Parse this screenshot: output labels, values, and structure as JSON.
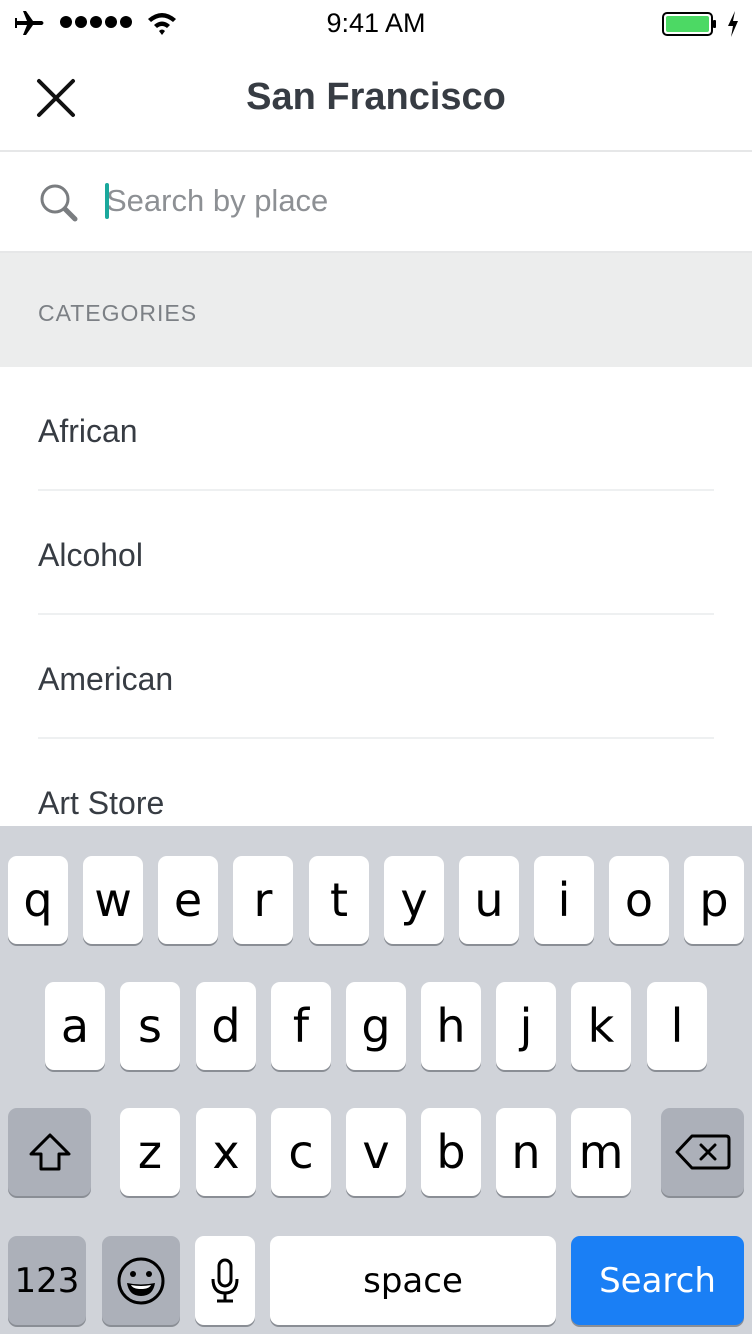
{
  "status_bar": {
    "time": "9:41 AM",
    "airplane_icon": "airplane-icon",
    "signal_dots": 5,
    "wifi_icon": "wifi-icon",
    "battery_level_percent": 100,
    "battery_color": "#4cd964",
    "charging_icon": "bolt-icon"
  },
  "nav": {
    "close_icon": "close-icon",
    "title": "San Francisco"
  },
  "search": {
    "icon": "search-icon",
    "placeholder": "Search by place",
    "value": "",
    "cursor_color": "#1aa89c"
  },
  "categories": {
    "header": "CATEGORIES",
    "items": [
      {
        "label": "African"
      },
      {
        "label": "Alcohol"
      },
      {
        "label": "American"
      },
      {
        "label": "Art Store"
      }
    ]
  },
  "keyboard": {
    "row1": [
      "q",
      "w",
      "e",
      "r",
      "t",
      "y",
      "u",
      "i",
      "o",
      "p"
    ],
    "row2": [
      "a",
      "s",
      "d",
      "f",
      "g",
      "h",
      "j",
      "k",
      "l"
    ],
    "row3": [
      "z",
      "x",
      "c",
      "v",
      "b",
      "n",
      "m"
    ],
    "shift_icon": "shift-icon",
    "backspace_icon": "backspace-icon",
    "numbers_label": "123",
    "emoji_icon": "emoji-icon",
    "mic_icon": "microphone-icon",
    "space_label": "space",
    "search_label": "Search",
    "search_color": "#1a7ff5"
  }
}
